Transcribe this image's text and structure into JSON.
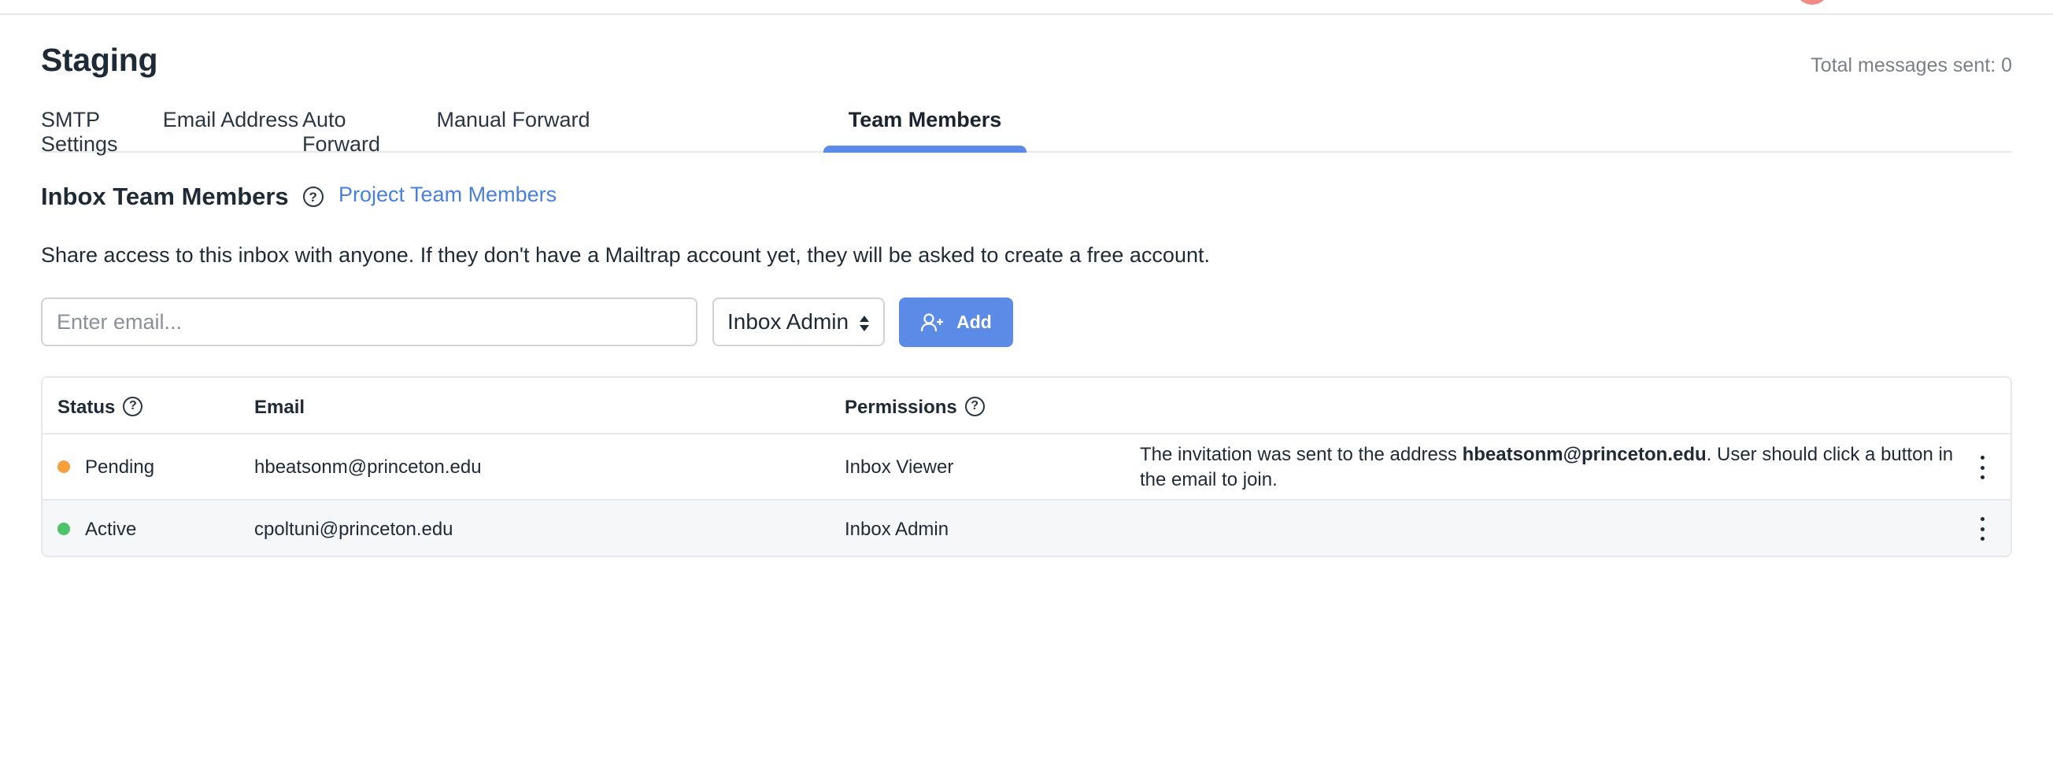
{
  "page": {
    "title": "Staging",
    "total_messages": "Total messages sent: 0"
  },
  "tabs": [
    {
      "label": "SMTP Settings",
      "active": false
    },
    {
      "label": "Email Address",
      "active": false
    },
    {
      "label": "Auto Forward",
      "active": false
    },
    {
      "label": "Manual Forward",
      "active": false
    },
    {
      "label": "Team Members",
      "active": true
    }
  ],
  "section": {
    "title": "Inbox Team Members",
    "help_icon": "question-circle-icon",
    "project_link": "Project Team Members",
    "description": "Share access to this inbox with anyone. If they don't have a Mailtrap account yet, they will be asked to create a free account."
  },
  "invite_form": {
    "email_placeholder": "Enter email...",
    "email_value": "",
    "role_selected": "Inbox Admin",
    "add_label": "Add",
    "add_icon": "user-plus-icon"
  },
  "table": {
    "headers": {
      "status": "Status",
      "email": "Email",
      "permissions": "Permissions"
    },
    "rows": [
      {
        "status": "Pending",
        "status_color": "#f5a03a",
        "email": "hbeatsonm@princeton.edu",
        "permission": "Inbox Viewer",
        "note_prefix": "The invitation was sent to the address ",
        "note_email": "hbeatsonm@princeton.edu",
        "note_suffix": ". User should click a button in the email to join."
      },
      {
        "status": "Active",
        "status_color": "#4cc26a",
        "email": "cpoltuni@princeton.edu",
        "permission": "Inbox Admin",
        "note_prefix": "",
        "note_email": "",
        "note_suffix": ""
      }
    ]
  },
  "colors": {
    "accent": "#5b8be6",
    "link": "#4a7fdd",
    "pending": "#f5a03a",
    "active": "#4cc26a"
  }
}
